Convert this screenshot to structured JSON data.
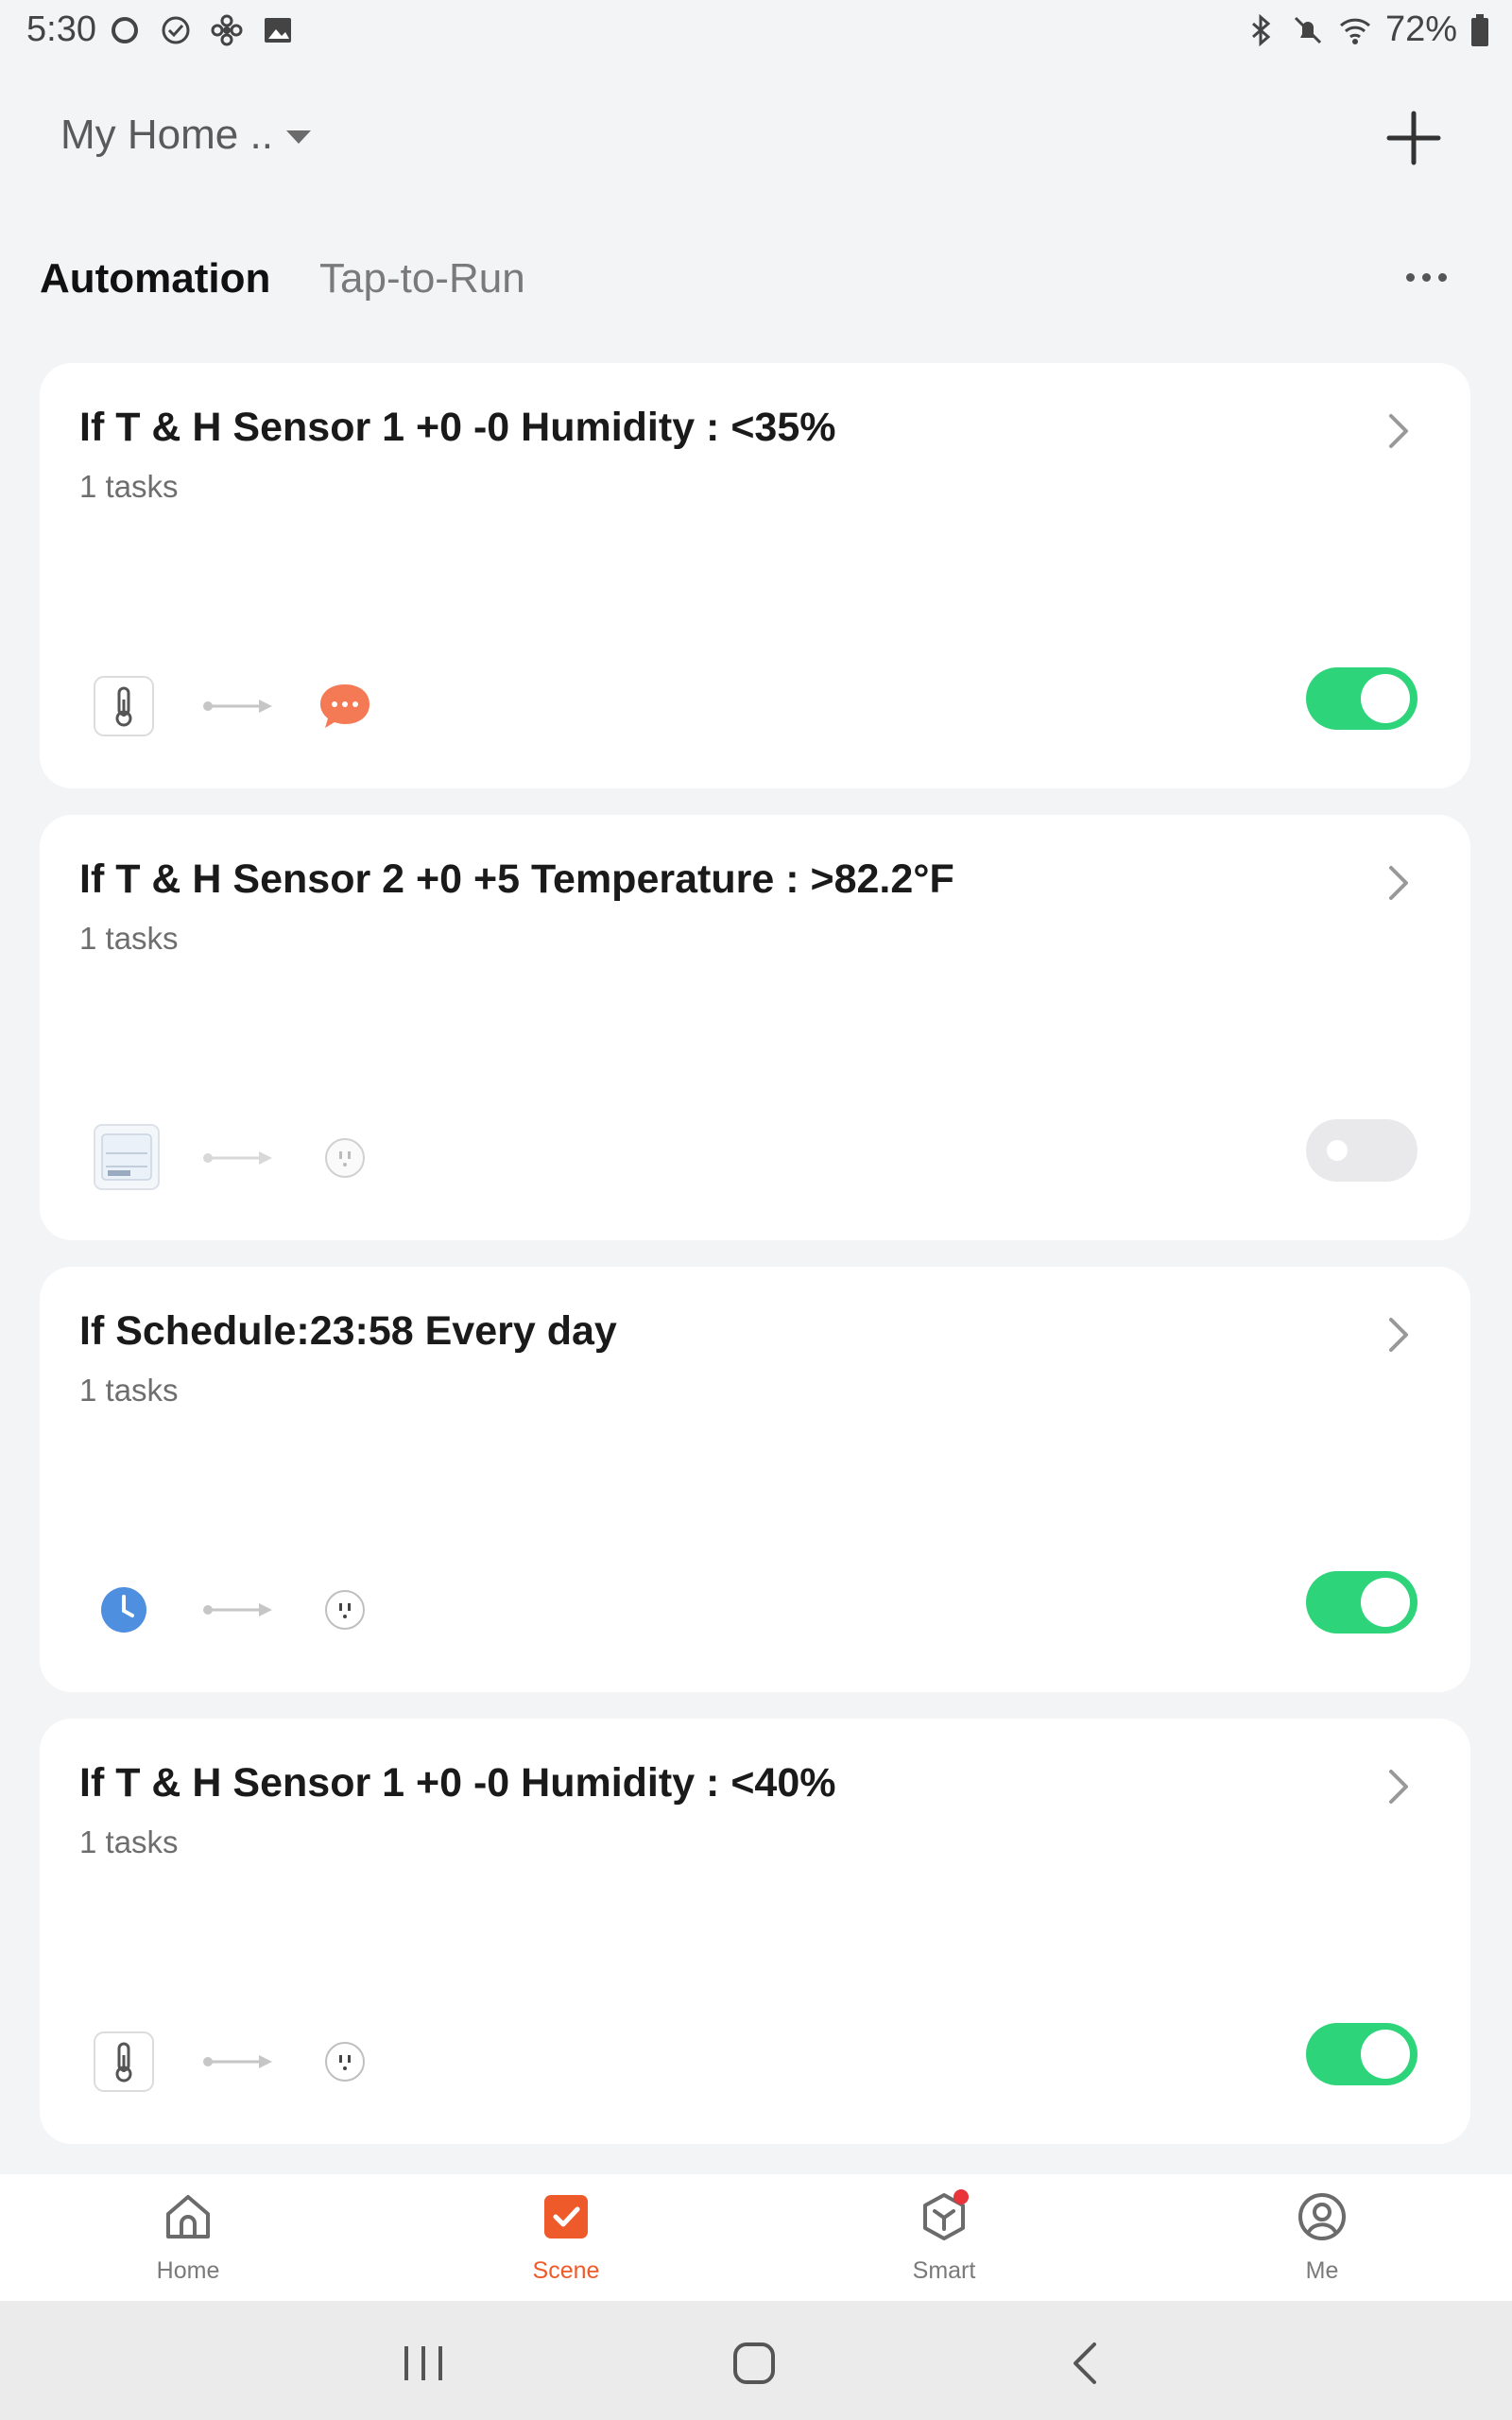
{
  "status_bar": {
    "time": "5:30",
    "battery": "72%",
    "icons": [
      "circle-icon",
      "check-circle-icon",
      "fan-icon",
      "image-icon",
      "bluetooth-icon",
      "mute-icon",
      "wifi-icon",
      "battery-icon"
    ]
  },
  "header": {
    "home_name": "My Home ..",
    "add_icon": "plus-icon"
  },
  "tabs": [
    {
      "label": "Automation",
      "active": true
    },
    {
      "label": "Tap-to-Run",
      "active": false
    }
  ],
  "automations": [
    {
      "title": "If T & H Sensor 1 +0 -0 Humidity : <35%",
      "subtitle": "1 tasks",
      "condition_icon": "thermometer-icon",
      "action_icon": "message-icon",
      "enabled": true
    },
    {
      "title": "If T & H Sensor 2 +0 +5 Temperature : >82.2°F",
      "subtitle": "1 tasks",
      "condition_icon": "display-sensor-icon",
      "action_icon": "outlet-icon",
      "enabled": false
    },
    {
      "title": "If Schedule:23:58 Every day",
      "subtitle": "1 tasks",
      "condition_icon": "clock-icon",
      "action_icon": "outlet-icon",
      "enabled": true
    },
    {
      "title": "If T & H Sensor 1 +0 -0 Humidity : <40%",
      "subtitle": "1 tasks",
      "condition_icon": "thermometer-icon",
      "action_icon": "outlet-icon",
      "enabled": true
    }
  ],
  "bottom_nav": [
    {
      "label": "Home",
      "icon": "home-icon",
      "active": false
    },
    {
      "label": "Scene",
      "icon": "scene-icon",
      "active": true
    },
    {
      "label": "Smart",
      "icon": "smart-icon",
      "active": false,
      "badge": true
    },
    {
      "label": "Me",
      "icon": "user-icon",
      "active": false
    }
  ],
  "colors": {
    "accent": "#ef5a2a",
    "toggle_on": "#2ed47a",
    "toggle_off": "#e9e9eb",
    "background": "#f3f4f6",
    "clock_blue": "#4f8fe0",
    "message_orange": "#f47a55"
  }
}
